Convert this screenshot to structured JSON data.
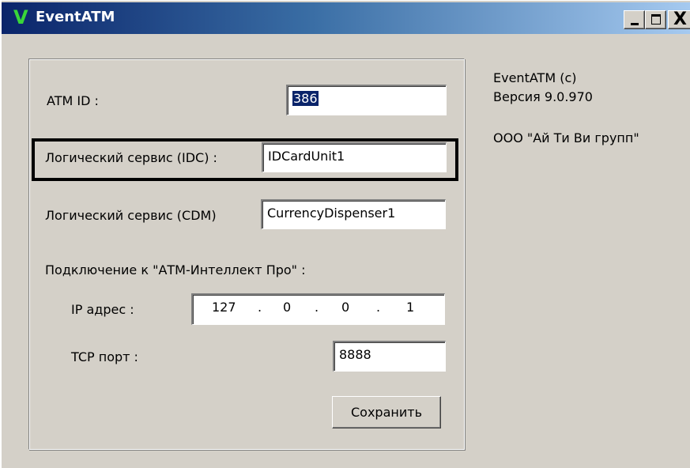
{
  "window": {
    "title": "EventATM",
    "icon_glyph": "V",
    "icon_color": "#39d639",
    "title_gradient": [
      "#0a246a",
      "#a6caf0"
    ],
    "buttons": {
      "minimize_icon": "minimize-icon",
      "maximize_icon": "maximize-icon",
      "close_icon": "close-icon",
      "close_glyph": "X"
    }
  },
  "form": {
    "atm_id": {
      "label": "ATM ID :",
      "value": "386"
    },
    "idc": {
      "label": "Логический сервис (IDC) :",
      "value": "IDCardUnit1"
    },
    "cdm": {
      "label": "Логический сервис (CDM)",
      "value": "CurrencyDispenser1"
    },
    "connection_header": "Подключение к \"АТМ-Интеллект Про\" :",
    "ip": {
      "label": "IP адрес :",
      "octets": [
        "127",
        "0",
        "0",
        "1"
      ],
      "separator": "."
    },
    "port": {
      "label": "TCP порт :",
      "value": "8888"
    },
    "save_label": "Сохранить"
  },
  "info": {
    "product": "EventATM (c)",
    "version": "Версия 9.0.970",
    "company": "ООО \"Ай Ти Ви групп\""
  },
  "colors": {
    "face": "#d4d0c8",
    "selection": "#0a246a",
    "highlight_border": "#000000"
  }
}
